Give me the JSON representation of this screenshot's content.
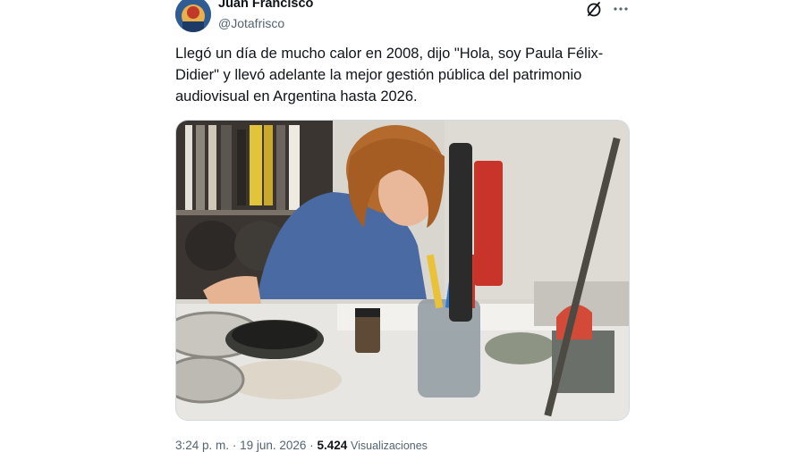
{
  "author": {
    "display_name": "Juan Francisco",
    "handle": "@Jotafrisco",
    "avatar_icon": "profile-avatar"
  },
  "actions": {
    "grok_icon": "slash-circle-icon",
    "more_icon": "more-horizontal-icon"
  },
  "tweet": {
    "text": "Llegó un día de mucho calor en 2008, dijo \"Hola, soy Paula Félix-Didier\" y llevó adelante la mejor gestión pública del patrimonio audiovisual en Argentina hasta 2026."
  },
  "meta": {
    "time": "3:24 p. m.",
    "separator": "·",
    "date": "19 jun. 2026",
    "views_count": "5.424",
    "views_label": "Visualizaciones"
  },
  "colors": {
    "text_primary": "#0f1419",
    "text_secondary": "#536471",
    "border": "#cfd9de"
  }
}
